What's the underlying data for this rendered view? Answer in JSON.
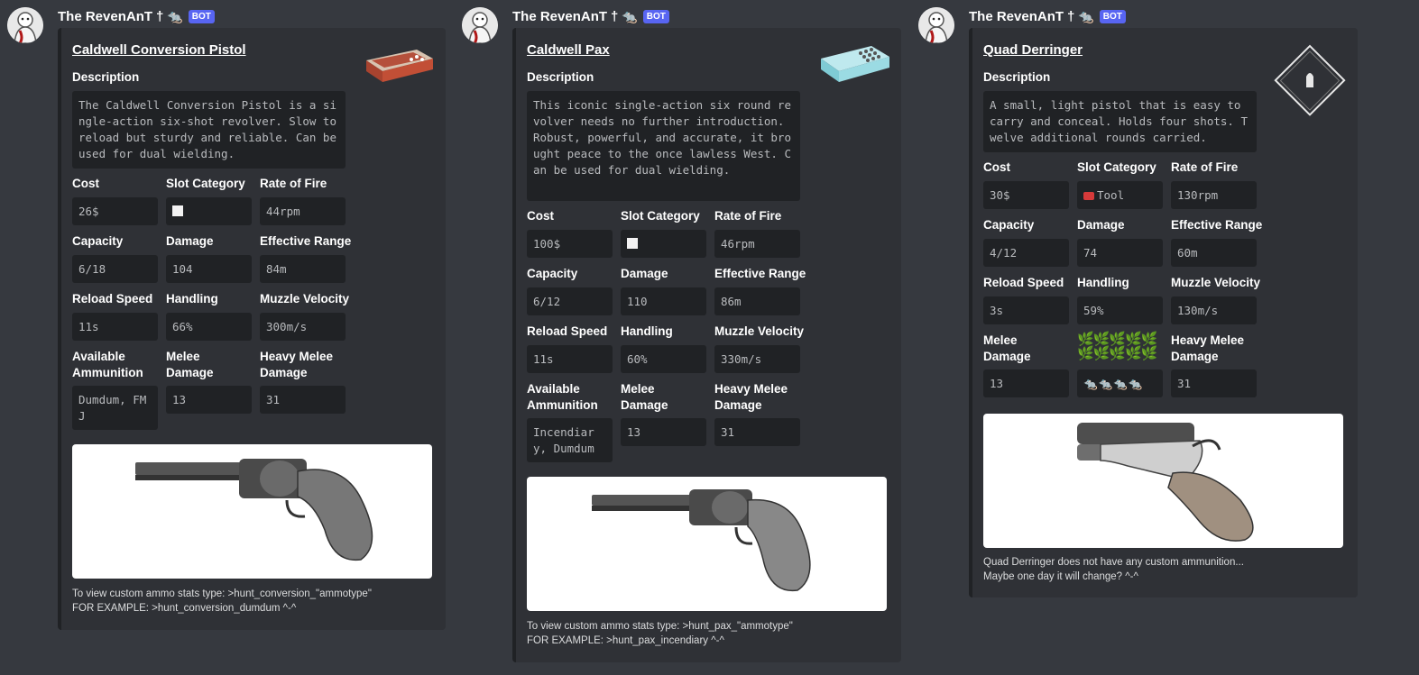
{
  "bot": {
    "username": "The RevenAnT",
    "suffix": "†",
    "rat_emoji": "🐀",
    "tag": "BOT"
  },
  "labels": {
    "description": "Description",
    "cost": "Cost",
    "slot_category": "Slot Category",
    "rate_of_fire": "Rate of Fire",
    "capacity": "Capacity",
    "damage": "Damage",
    "effective_range": "Effective Range",
    "reload_speed": "Reload Speed",
    "handling": "Handling",
    "muzzle_velocity": "Muzzle Velocity",
    "available_ammunition": "Available Ammunition",
    "melee_damage": "Melee Damage",
    "heavy_melee_damage": "Heavy Melee Damage"
  },
  "weapons": [
    {
      "title": "Caldwell Conversion Pistol",
      "description": "The Caldwell Conversion Pistol is a single-action six-shot revolver. Slow to reload but sturdy and reliable. Can be used for dual wielding.",
      "cost": "26$",
      "rate_of_fire": "44rpm",
      "capacity": "6/18",
      "damage": "104",
      "effective_range": "84m",
      "reload_speed": "11s",
      "handling": "66%",
      "muzzle_velocity": "300m/s",
      "ammunition": "Dumdum, FMJ",
      "melee_damage": "13",
      "heavy_melee_damage": "31",
      "footer_line1": "To view custom ammo stats type: >hunt_conversion_\"ammotype\"",
      "footer_line2": "FOR EXAMPLE: >hunt_conversion_dumdum ^-^",
      "thumb_icon": "red-ammo-box-icon",
      "image_icon": "revolver-image"
    },
    {
      "title": "Caldwell Pax",
      "description": "This iconic single-action six round revolver needs no further introduction. Robust, powerful, and accurate, it brought peace to the once lawless West. Can be used for dual wielding.",
      "cost": "100$",
      "rate_of_fire": "46rpm",
      "capacity": "6/12",
      "damage": "110",
      "effective_range": "86m",
      "reload_speed": "11s",
      "handling": "60%",
      "muzzle_velocity": "330m/s",
      "ammunition": "Incendiary, Dumdum",
      "melee_damage": "13",
      "heavy_melee_damage": "31",
      "footer_line1": "To view custom ammo stats type: >hunt_pax_\"ammotype\"",
      "footer_line2": "FOR EXAMPLE: >hunt_pax_incendiary ^-^",
      "thumb_icon": "blue-ammo-box-icon",
      "image_icon": "revolver-image"
    },
    {
      "title": "Quad Derringer",
      "description": "A small, light pistol that is easy to carry and conceal. Holds four shots. Twelve additional rounds carried.",
      "cost": "30$",
      "slot_category": "Tool",
      "rate_of_fire": "130rpm",
      "capacity": "4/12",
      "damage": "74",
      "effective_range": "60m",
      "reload_speed": "3s",
      "handling": "59%",
      "muzzle_velocity": "130m/s",
      "melee_damage": "13",
      "heavy_melee_damage": "31",
      "rats": "🐀🐀🐀🐀",
      "herbs": "🌿🌿🌿🌿🌿🌿🌿🌿🌿🌿",
      "footer_line1": "Quad Derringer does not have any custom ammunition...",
      "footer_line2": "Maybe one day it will change? ^-^",
      "thumb_icon": "diamond-bullet-icon",
      "image_icon": "derringer-image"
    }
  ],
  "colors": {
    "background": "#36393f",
    "embed": "#2f3136",
    "codebox": "#202225",
    "bot_tag": "#5865f2"
  }
}
